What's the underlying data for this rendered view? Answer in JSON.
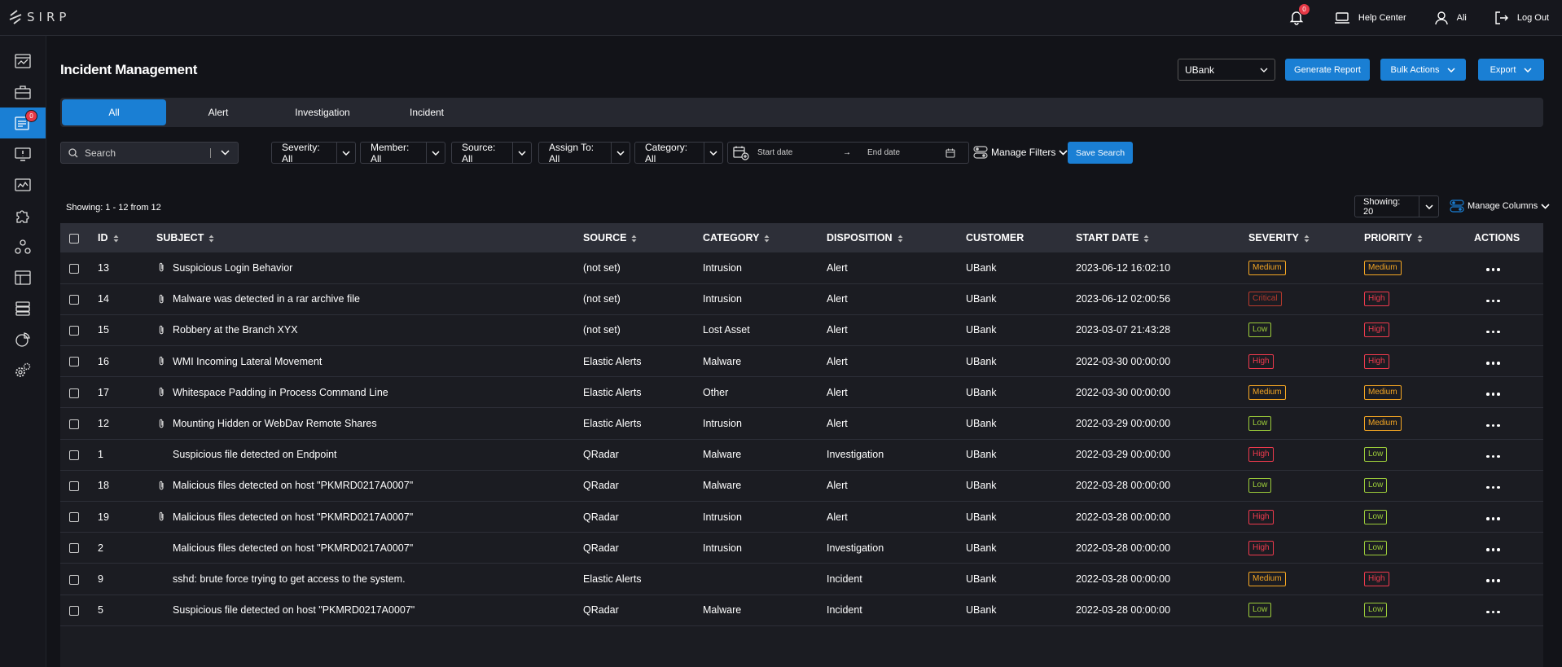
{
  "brand": {
    "logo_text": "SIRP"
  },
  "topbar": {
    "notifications_count": "0",
    "help_center": "Help Center",
    "user_name": "Ali",
    "logout": "Log Out"
  },
  "sidebar": {
    "items": [
      {
        "icon": "dashboard-icon"
      },
      {
        "icon": "briefcase-icon"
      },
      {
        "icon": "incidents-icon",
        "active": true,
        "badge": "0"
      },
      {
        "icon": "threat-monitor-icon"
      },
      {
        "icon": "analytics-icon"
      },
      {
        "icon": "integrations-puzzle-icon"
      },
      {
        "icon": "hub-icon"
      },
      {
        "icon": "reports-icon"
      },
      {
        "icon": "database-icon"
      },
      {
        "icon": "pie-chart-icon"
      },
      {
        "icon": "settings-gears-icon"
      }
    ]
  },
  "page": {
    "title": "Incident Management",
    "customer_select": "UBank",
    "generate_report": "Generate Report",
    "bulk_actions": "Bulk Actions",
    "export": "Export"
  },
  "tabs": [
    "All",
    "Alert",
    "Investigation",
    "Incident"
  ],
  "filters": {
    "search_placeholder": "Search",
    "severity": "Severity: All",
    "member": "Member: All",
    "source": "Source: All",
    "assign_to": "Assign To: All",
    "category": "Category: All",
    "start_date_placeholder": "Start date",
    "end_date_placeholder": "End date",
    "manage_filters": "Manage Filters",
    "save_search": "Save Search"
  },
  "listing": {
    "showing_text": "Showing: 1 - 12 from 12",
    "page_size": "Showing: 20",
    "manage_columns": "Manage Columns"
  },
  "table": {
    "columns": [
      "ID",
      "SUBJECT",
      "SOURCE",
      "CATEGORY",
      "DISPOSITION",
      "CUSTOMER",
      "START DATE",
      "SEVERITY",
      "PRIORITY",
      "ACTIONS"
    ],
    "rows": [
      {
        "id": "13",
        "subject": "Suspicious Login Behavior",
        "attached": true,
        "source": "(not set)",
        "category": "Intrusion",
        "disposition": "Alert",
        "customer": "UBank",
        "start_date": "2023-06-12 16:02:10",
        "severity": "Medium",
        "priority": "Medium"
      },
      {
        "id": "14",
        "subject": "Malware was detected in a rar archive file",
        "attached": true,
        "source": "(not set)",
        "category": "Intrusion",
        "disposition": "Alert",
        "customer": "UBank",
        "start_date": "2023-06-12 02:00:56",
        "severity": "Critical",
        "priority": "High"
      },
      {
        "id": "15",
        "subject": "Robbery at the Branch XYX",
        "attached": true,
        "source": "(not set)",
        "category": "Lost Asset",
        "disposition": "Alert",
        "customer": "UBank",
        "start_date": "2023-03-07 21:43:28",
        "severity": "Low",
        "priority": "High"
      },
      {
        "id": "16",
        "subject": "WMI Incoming Lateral Movement",
        "attached": true,
        "source": "Elastic Alerts",
        "category": "Malware",
        "disposition": "Alert",
        "customer": "UBank",
        "start_date": "2022-03-30 00:00:00",
        "severity": "High",
        "priority": "High"
      },
      {
        "id": "17",
        "subject": "Whitespace Padding in Process Command Line",
        "attached": true,
        "source": "Elastic Alerts",
        "category": "Other",
        "disposition": "Alert",
        "customer": "UBank",
        "start_date": "2022-03-30 00:00:00",
        "severity": "Medium",
        "priority": "Medium"
      },
      {
        "id": "12",
        "subject": "Mounting Hidden or WebDav Remote Shares",
        "attached": true,
        "source": "Elastic Alerts",
        "category": "Intrusion",
        "disposition": "Alert",
        "customer": "UBank",
        "start_date": "2022-03-29 00:00:00",
        "severity": "Low",
        "priority": "Medium"
      },
      {
        "id": "1",
        "subject": "Suspicious file detected on Endpoint",
        "attached": false,
        "source": "QRadar",
        "category": "Malware",
        "disposition": "Investigation",
        "customer": "UBank",
        "start_date": "2022-03-29 00:00:00",
        "severity": "High",
        "priority": "Low"
      },
      {
        "id": "18",
        "subject": "Malicious files detected on host \"PKMRD0217A0007\"",
        "attached": true,
        "source": "QRadar",
        "category": "Malware",
        "disposition": "Alert",
        "customer": "UBank",
        "start_date": "2022-03-28 00:00:00",
        "severity": "Low",
        "priority": "Low"
      },
      {
        "id": "19",
        "subject": "Malicious files detected on host \"PKMRD0217A0007\"",
        "attached": true,
        "source": "QRadar",
        "category": "Intrusion",
        "disposition": "Alert",
        "customer": "UBank",
        "start_date": "2022-03-28 00:00:00",
        "severity": "High",
        "priority": "Low"
      },
      {
        "id": "2",
        "subject": "Malicious files detected on host \"PKMRD0217A0007\"",
        "attached": false,
        "source": "QRadar",
        "category": "Intrusion",
        "disposition": "Investigation",
        "customer": "UBank",
        "start_date": "2022-03-28 00:00:00",
        "severity": "High",
        "priority": "Low"
      },
      {
        "id": "9",
        "subject": "sshd: brute force trying to get access to the system.",
        "attached": false,
        "source": "Elastic Alerts",
        "category": "",
        "disposition": "Incident",
        "customer": "UBank",
        "start_date": "2022-03-28 00:00:00",
        "severity": "Medium",
        "priority": "High"
      },
      {
        "id": "5",
        "subject": "Suspicious file detected on host \"PKMRD0217A0007\"",
        "attached": false,
        "source": "QRadar",
        "category": "Malware",
        "disposition": "Incident",
        "customer": "UBank",
        "start_date": "2022-03-28 00:00:00",
        "severity": "Low",
        "priority": "Low"
      }
    ]
  },
  "colors": {
    "accent": "#1a7fd4",
    "medium": "#f5a623",
    "high": "#ef3a4d",
    "critical": "#b83a2d",
    "low": "#9ccc3a"
  }
}
